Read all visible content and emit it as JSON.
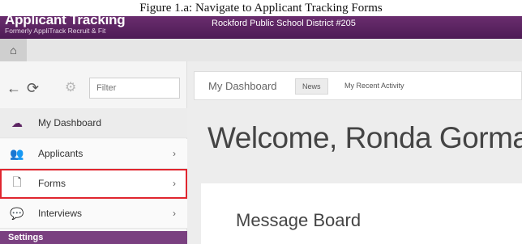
{
  "caption": "Figure 1.a: Navigate to Applicant Tracking Forms",
  "header": {
    "brand_title": "Applicant Tracking",
    "brand_subtitle": "Formerly AppliTrack Recruit & Fit",
    "district": "Rockford Public School District #205"
  },
  "homebar": {
    "home_icon": "home-icon"
  },
  "sidebar": {
    "filter_placeholder": "Filter",
    "items": [
      {
        "label": "My Dashboard",
        "icon": "cloud-icon"
      },
      {
        "label": "Applicants",
        "icon": "users-icon",
        "chevron": "›"
      },
      {
        "label": "Forms",
        "icon": "file-icon",
        "chevron": "›"
      },
      {
        "label": "Interviews",
        "icon": "chat-icon",
        "chevron": "›"
      }
    ],
    "section_label": "Settings"
  },
  "main": {
    "tabs": [
      {
        "label": "My Dashboard"
      },
      {
        "label": "News"
      },
      {
        "label": "My Recent Activity"
      }
    ],
    "welcome": "Welcome, Ronda Gorman",
    "board_title": "Message Board"
  },
  "colors": {
    "header": "#5b2361",
    "settings": "#7a4080",
    "highlight": "#e0262f"
  }
}
